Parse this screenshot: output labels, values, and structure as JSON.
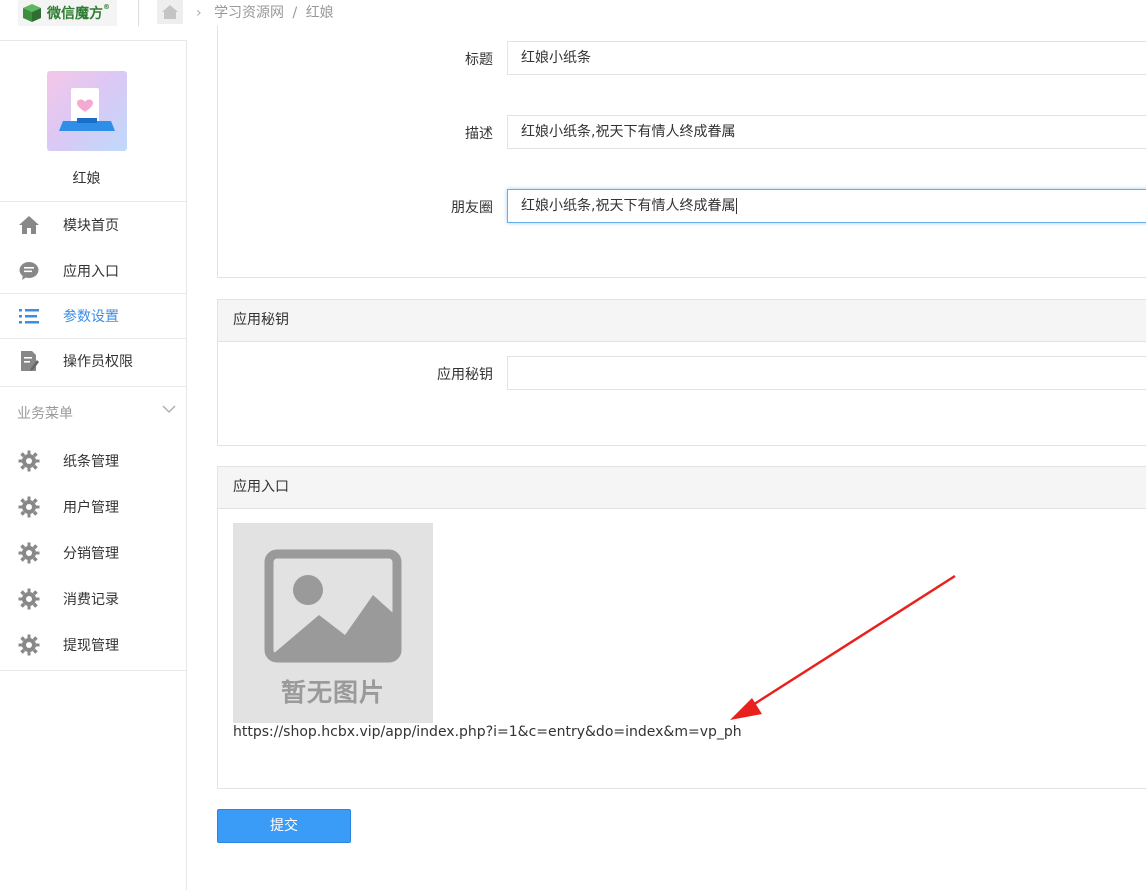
{
  "header": {
    "logo_text": "微信魔方",
    "logo_reg": "®",
    "breadcrumb": [
      "学习资源网",
      "红娘"
    ],
    "breadcrumb_sep": "/"
  },
  "sidebar": {
    "app_name": "红娘",
    "items": [
      {
        "label": "模块首页",
        "icon": "home-icon"
      },
      {
        "label": "应用入口",
        "icon": "chat-icon"
      },
      {
        "label": "参数设置",
        "icon": "list-icon",
        "active": true
      },
      {
        "label": "操作员权限",
        "icon": "edit-doc-icon"
      }
    ],
    "group_title": "业务菜单",
    "group_items": [
      {
        "label": "纸条管理",
        "icon": "gear-icon"
      },
      {
        "label": "用户管理",
        "icon": "gear-icon"
      },
      {
        "label": "分销管理",
        "icon": "gear-icon"
      },
      {
        "label": "消费记录",
        "icon": "gear-icon"
      },
      {
        "label": "提现管理",
        "icon": "gear-icon"
      }
    ]
  },
  "share_form": {
    "title_label": "标题",
    "title_value": "红娘小纸条",
    "desc_label": "描述",
    "desc_value": "红娘小纸条,祝天下有情人终成眷属",
    "moments_label": "朋友圈",
    "moments_value": "红娘小纸条,祝天下有情人终成眷属"
  },
  "secret_panel": {
    "title": "应用秘钥",
    "field_label": "应用秘钥",
    "field_value": ""
  },
  "entry_panel": {
    "title": "应用入口",
    "no_image_text": "暂无图片",
    "url": "https://shop.hcbx.vip/app/index.php?i=1&c=entry&do=index&m=vp_ph"
  },
  "submit_label": "提交",
  "colors": {
    "accent": "#3a9cf7",
    "active_nav": "#3a8ee6",
    "annotation_arrow": "#e8211d",
    "logo_green": "#2f7d32"
  }
}
